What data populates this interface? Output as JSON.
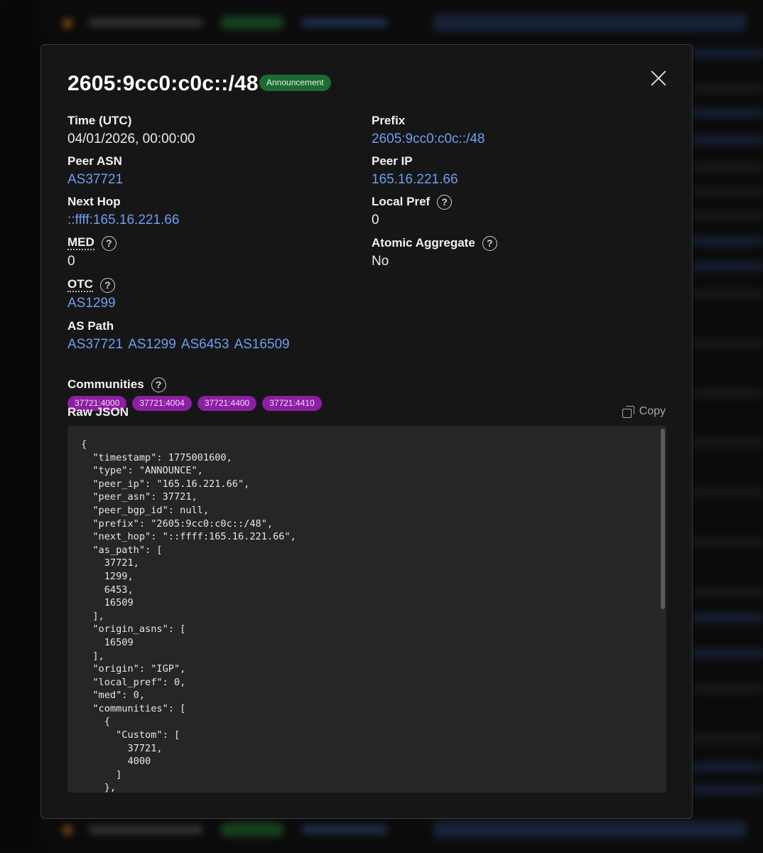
{
  "modal": {
    "title": "2605:9cc0:c0c::/48",
    "badge": "Announcement",
    "close_icon": "close-icon"
  },
  "fields": {
    "time": {
      "label": "Time (UTC)",
      "value": "04/01/2026, 00:00:00"
    },
    "prefix": {
      "label": "Prefix",
      "value": "2605:9cc0:c0c::/48"
    },
    "peer_asn": {
      "label": "Peer ASN",
      "value": "AS37721"
    },
    "peer_ip": {
      "label": "Peer IP",
      "value": "165.16.221.66"
    },
    "next_hop": {
      "label": "Next Hop",
      "value": "::ffff:165.16.221.66"
    },
    "local_pref": {
      "label": "Local Pref",
      "value": "0"
    },
    "med": {
      "label": "MED",
      "value": "0"
    },
    "atomic_aggregate": {
      "label": "Atomic Aggregate",
      "value": "No"
    },
    "otc": {
      "label": "OTC",
      "value": "AS1299"
    },
    "as_path": {
      "label": "AS Path",
      "values": [
        "AS37721",
        "AS1299",
        "AS6453",
        "AS16509"
      ]
    },
    "communities": {
      "label": "Communities",
      "values": [
        "37721:4000",
        "37721:4004",
        "37721:4400",
        "37721:4410"
      ]
    }
  },
  "help_icon_glyph": "?",
  "raw": {
    "label": "Raw JSON",
    "copy_label": "Copy",
    "json_text": "{\n  \"timestamp\": 1775001600,\n  \"type\": \"ANNOUNCE\",\n  \"peer_ip\": \"165.16.221.66\",\n  \"peer_asn\": 37721,\n  \"peer_bgp_id\": null,\n  \"prefix\": \"2605:9cc0:c0c::/48\",\n  \"next_hop\": \"::ffff:165.16.221.66\",\n  \"as_path\": [\n    37721,\n    1299,\n    6453,\n    16509\n  ],\n  \"origin_asns\": [\n    16509\n  ],\n  \"origin\": \"IGP\",\n  \"local_pref\": 0,\n  \"med\": 0,\n  \"communities\": [\n    {\n      \"Custom\": [\n        37721,\n        4000\n      ]\n    },"
  },
  "colors": {
    "link": "#6d9ef0",
    "announcement_badge": "#1d6b32",
    "community_chip": "#8c1fa3"
  }
}
